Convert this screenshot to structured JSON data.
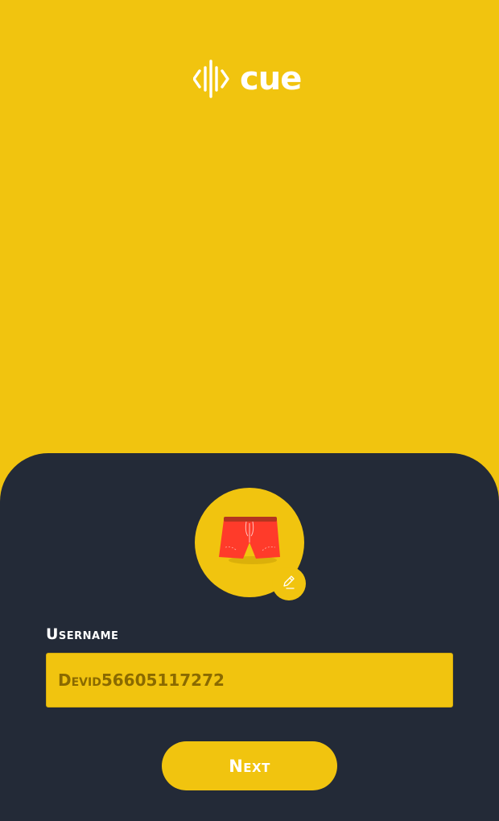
{
  "logo": {
    "text": "cue",
    "icon": "sound-wave-logo-icon"
  },
  "profile": {
    "avatar_icon": "shorts-icon",
    "edit_icon": "pencil-icon"
  },
  "form": {
    "username_label": "Username",
    "username_value": "Devid56605117272"
  },
  "actions": {
    "next_label": "Next"
  },
  "colors": {
    "brand_yellow": "#F1C40F",
    "panel_dark": "#232A37",
    "shorts_red": "#FF3B2A",
    "waistband": "#B33520",
    "input_text": "#8A6A00"
  }
}
